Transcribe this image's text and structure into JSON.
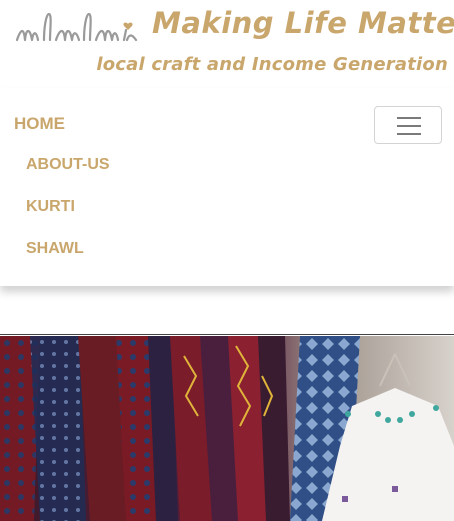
{
  "brand": {
    "logo_text": "mlm",
    "title": "Making Life Matter",
    "tagline": "local craft and Income Generation"
  },
  "nav": {
    "home": "HOME",
    "items": [
      "ABOUT-US",
      "KURTI",
      "SHAWL"
    ]
  },
  "colors": {
    "brand_gold": "#c9a66b",
    "logo_gray": "#9a9a9a",
    "toggler_border": "#d4d4d4"
  },
  "icons": {
    "toggler": "hamburger-menu-icon",
    "logo_heart": "heart-icon"
  },
  "banner": {
    "description": "hanging-garments-photo"
  }
}
